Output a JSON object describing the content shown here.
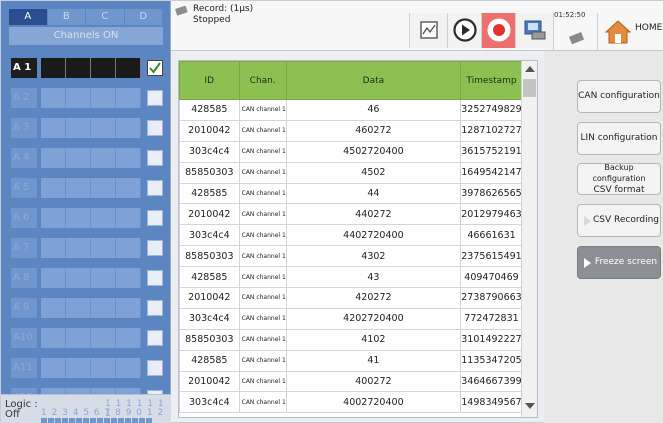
{
  "channels": {
    "tabs": [
      "A",
      "B",
      "C",
      "D"
    ],
    "active_tab": "A",
    "channels_on_label": "Channels ON",
    "rows": [
      {
        "label": "A 1",
        "active": true,
        "checked": true
      },
      {
        "label": "A 2",
        "active": false,
        "checked": false
      },
      {
        "label": "A 3",
        "active": false,
        "checked": false
      },
      {
        "label": "A 4",
        "active": false,
        "checked": false
      },
      {
        "label": "A 5",
        "active": false,
        "checked": false
      },
      {
        "label": "A 6",
        "active": false,
        "checked": false
      },
      {
        "label": "A 7",
        "active": false,
        "checked": false
      },
      {
        "label": "A 8",
        "active": false,
        "checked": false
      },
      {
        "label": "A 9",
        "active": false,
        "checked": false
      },
      {
        "label": "A10",
        "active": false,
        "checked": false
      },
      {
        "label": "A11",
        "active": false,
        "checked": false
      },
      {
        "label": "A12",
        "active": false,
        "checked": false
      }
    ]
  },
  "logic": {
    "label": "Logic :",
    "state": "Off",
    "digits_top": "1 1 1 1 1 1 1",
    "digits": "1 2 3 4 5 6 7 8 9 0 1 2 3 4 5 6"
  },
  "record": {
    "title": "Record: (1µs)",
    "status": "Stopped"
  },
  "toolbar": {
    "clock": "01:52:50",
    "home_label": "HOME"
  },
  "table": {
    "headers": [
      "ID",
      "Chan.",
      "Data",
      "Timestamp"
    ],
    "rows": [
      [
        "428585",
        "CAN channel 1",
        "46",
        "3252749829"
      ],
      [
        "2010042",
        "CAN channel 1",
        "460272",
        "1287102727"
      ],
      [
        "303c4c4",
        "CAN channel 1",
        "4502720400",
        "3615752191"
      ],
      [
        "85850303",
        "CAN channel 1",
        "4502",
        "1649542147"
      ],
      [
        "428585",
        "CAN channel 1",
        "44",
        "3978626565"
      ],
      [
        "2010042",
        "CAN channel 1",
        "440272",
        "2012979463"
      ],
      [
        "303c4c4",
        "CAN channel 1",
        "4402720400",
        "46661631"
      ],
      [
        "85850303",
        "CAN channel 1",
        "4302",
        "2375615491"
      ],
      [
        "428585",
        "CAN channel 1",
        "43",
        "409470469"
      ],
      [
        "2010042",
        "CAN channel 1",
        "420272",
        "2738790663"
      ],
      [
        "303c4c4",
        "CAN channel 1",
        "4202720400",
        "772472831"
      ],
      [
        "85850303",
        "CAN channel 1",
        "4102",
        "3101492227"
      ],
      [
        "428585",
        "CAN channel 1",
        "41",
        "1135347205"
      ],
      [
        "2010042",
        "CAN channel 1",
        "400272",
        "3464667399"
      ],
      [
        "303c4c4",
        "CAN channel 1",
        "4002720400",
        "1498349567"
      ]
    ]
  },
  "side_buttons": {
    "can": "CAN configuration",
    "lin": "LIN configuration",
    "backup_line1": "Backup configuration",
    "backup_line2": "CSV format",
    "csv": "CSV Recording",
    "freeze": "Freeze screen"
  },
  "colors": {
    "panel_blue": "#5b86c2",
    "header_green": "#8cc152",
    "record_red": "#ef6f6f"
  }
}
